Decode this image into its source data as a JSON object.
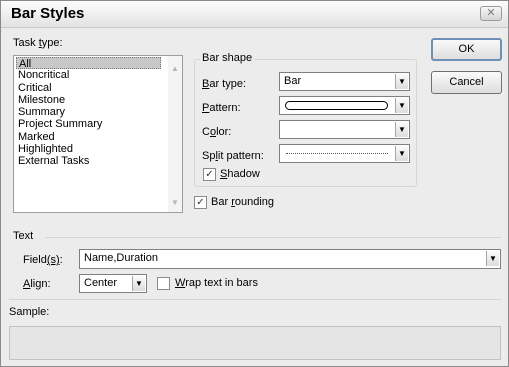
{
  "dialog": {
    "title": "Bar Styles",
    "close_icon": "close-icon"
  },
  "task_type": {
    "label_pre": "Task ",
    "label_key": "t",
    "label_post": "ype:",
    "items": [
      "All",
      "Noncritical",
      "Critical",
      "Milestone",
      "Summary",
      "Project Summary",
      "Marked",
      "Highlighted",
      "External Tasks"
    ],
    "selected": "All"
  },
  "bar_shape": {
    "group_label": "Bar shape",
    "bar_type": {
      "label_key": "B",
      "label_post": "ar type:",
      "value": "Bar"
    },
    "pattern": {
      "label_key": "P",
      "label_post": "attern:"
    },
    "color": {
      "label_pre": "C",
      "label_key": "o",
      "label_post": "lor:"
    },
    "split_pattern": {
      "label_pre": "Sp",
      "label_key": "l",
      "label_post": "it pattern:"
    },
    "shadow": {
      "label_key": "S",
      "label_post": "hadow",
      "checked": true
    }
  },
  "bar_rounding": {
    "label_pre": "Bar ",
    "label_key": "r",
    "label_post": "ounding",
    "checked": true
  },
  "buttons": {
    "ok": "OK",
    "cancel": "Cancel"
  },
  "text_section": {
    "group_label": "Text",
    "fields": {
      "label_pre": "Field",
      "label_key": "(s)",
      "label_post": ":",
      "value": "Name,Duration"
    },
    "align": {
      "label_key": "A",
      "label_post": "lign:",
      "value": "Center"
    },
    "wrap": {
      "label_key": "W",
      "label_post": "rap text in bars",
      "checked": false
    }
  },
  "sample": {
    "label": "Sample:"
  }
}
